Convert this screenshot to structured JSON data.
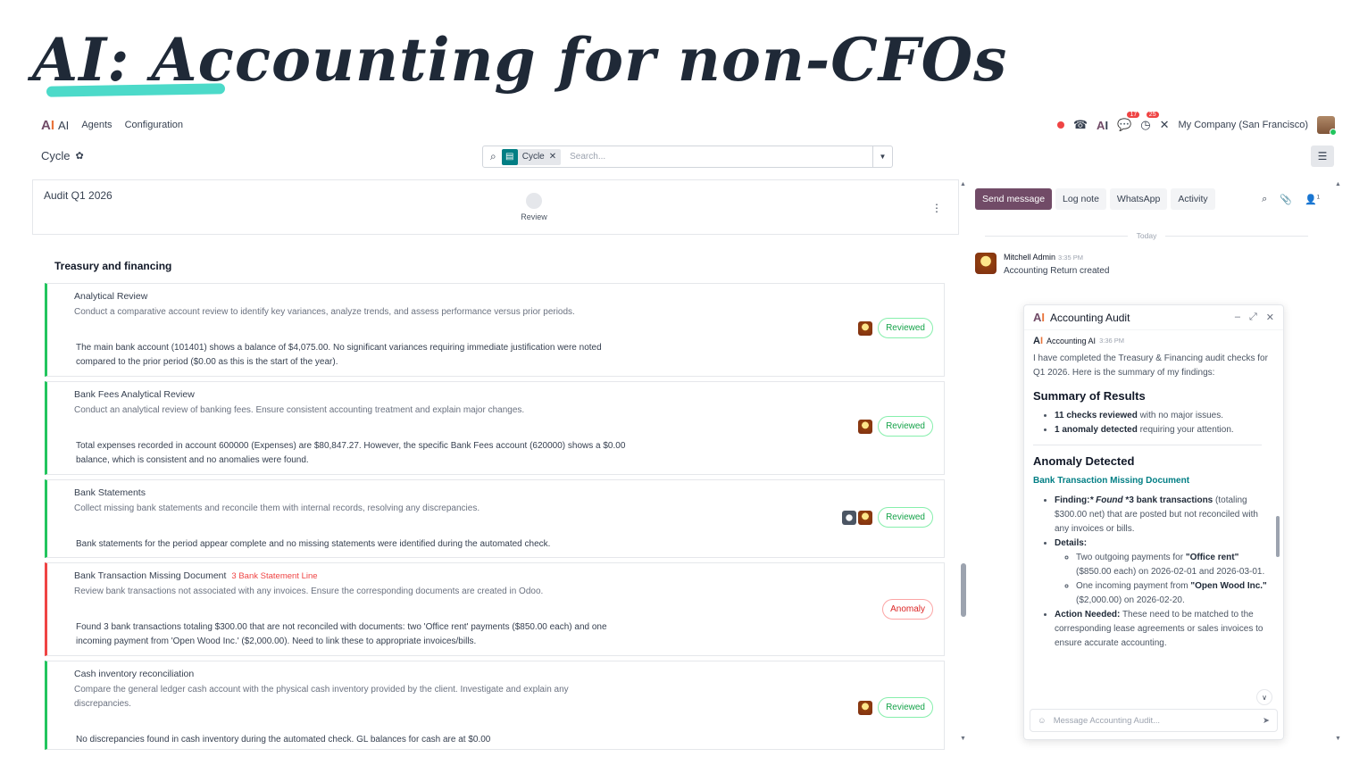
{
  "slide": {
    "title": "AI: Accounting for non-CFOs"
  },
  "topnav": {
    "app_name": "AI",
    "menu": [
      "Agents",
      "Configuration"
    ],
    "badges": {
      "discuss": "17",
      "activity": "25"
    },
    "company": "My Company (San Francisco)"
  },
  "control": {
    "breadcrumb": "Cycle",
    "facet_label": "Cycle",
    "search_placeholder": "Search..."
  },
  "record": {
    "name": "Audit Q1 2026",
    "stage": "Review"
  },
  "section": {
    "title": "Treasury and financing"
  },
  "checks": [
    {
      "title": "Analytical Review",
      "tag": "",
      "description": "Conduct a comparative account review to identify key variances, analyze trends, and assess performance versus prior periods.",
      "result": "The main bank account (101401) shows a balance of $4,075.00. No significant variances requiring immediate justification were noted compared to the prior period ($0.00 as this is the start of the year).",
      "status": "Reviewed"
    },
    {
      "title": "Bank Fees Analytical Review",
      "tag": "",
      "description": "Conduct an analytical review of banking fees. Ensure consistent accounting treatment and explain major changes.",
      "result": "Total expenses recorded in account 600000 (Expenses) are $80,847.27. However, the specific Bank Fees account (620000) shows a $0.00 balance, which is consistent and no anomalies were found.",
      "status": "Reviewed"
    },
    {
      "title": "Bank Statements",
      "tag": "",
      "description": "Collect missing bank statements and reconcile them with internal records, resolving any discrepancies.",
      "result": "Bank statements for the period appear complete and no missing statements were identified during the automated check.",
      "status": "Reviewed"
    },
    {
      "title": "Bank Transaction Missing Document",
      "tag": "3 Bank Statement Line",
      "description": "Review bank transactions not associated with any invoices. Ensure the corresponding documents are created in Odoo.",
      "result": "Found 3 bank transactions totaling $300.00 that are not reconciled with documents: two 'Office rent' payments ($850.00 each) and one incoming payment from 'Open Wood Inc.' ($2,000.00). Need to link these to appropriate invoices/bills.",
      "status": "Anomaly"
    },
    {
      "title": "Cash inventory reconciliation",
      "tag": "",
      "description": "Compare the general ledger cash account with the physical cash inventory provided by the client. Investigate and explain any discrepancies.",
      "result": "No discrepancies found in cash inventory during the automated check. GL balances for cash are at $0.00",
      "status": "Reviewed"
    }
  ],
  "chatter": {
    "tabs": [
      "Send message",
      "Log note",
      "WhatsApp",
      "Activity"
    ],
    "followers": "1",
    "today": "Today",
    "message": {
      "author": "Mitchell Admin",
      "time": "3:35 PM",
      "text": "Accounting Return created"
    }
  },
  "popup": {
    "title": "Accounting Audit",
    "sender": "Accounting AI",
    "time": "3:36 PM",
    "intro": "I have completed the Treasury & Financing audit checks for Q1 2026. Here is the summary of my findings:",
    "summary_heading": "Summary of Results",
    "summary_1_bold": "11 checks reviewed",
    "summary_1_rest": " with no major issues.",
    "summary_2_bold": "1 anomaly detected",
    "summary_2_rest": " requiring your attention.",
    "anomaly_heading": "Anomaly Detected",
    "anomaly_link": "Bank Transaction Missing Document",
    "finding_label": "Finding:",
    "finding_found": "* Found",
    "finding_bold": " *3 bank transactions",
    "finding_rest": " (totaling $300.00 net) that are posted but not reconciled with any invoices or bills.",
    "details_label": "Details:",
    "detail_1a": "Two outgoing payments for ",
    "detail_1b": "\"Office rent\"",
    "detail_1c": " ($850.00 each) on 2026-02-01 and 2026-03-01.",
    "detail_2a": "One incoming payment from ",
    "detail_2b": "\"Open Wood Inc.\"",
    "detail_2c": " ($2,000.00) on 2026-02-20.",
    "action_label": "Action Needed:",
    "action_rest": " These need to be matched to the corresponding lease agreements or sales invoices to ensure accurate accounting.",
    "input_placeholder": "Message Accounting Audit..."
  }
}
